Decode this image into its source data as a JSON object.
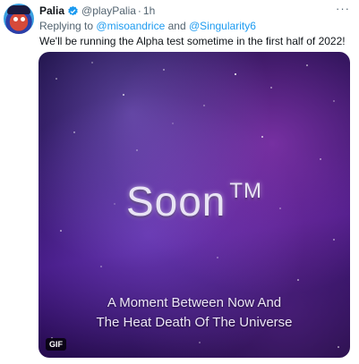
{
  "tweet": {
    "author_name": "Palia",
    "handle": "@playPalia",
    "separator": "·",
    "time": "1h",
    "more_label": "···",
    "reply_prefix": "Replying to",
    "reply_user1": "@misoandrice",
    "reply_and": "and",
    "reply_user2": "@Singularity6",
    "text": "We'll be running the Alpha test sometime in the first half of 2022!"
  },
  "media": {
    "title": "Soon",
    "trademark": "TM",
    "caption_line1": "A Moment Between Now And",
    "caption_line2": "The Heat Death Of The Universe",
    "badge": "GIF"
  },
  "colors": {
    "link": "#1d9bf0",
    "secondary_text": "#536471",
    "verified": "#1d9bf0"
  }
}
